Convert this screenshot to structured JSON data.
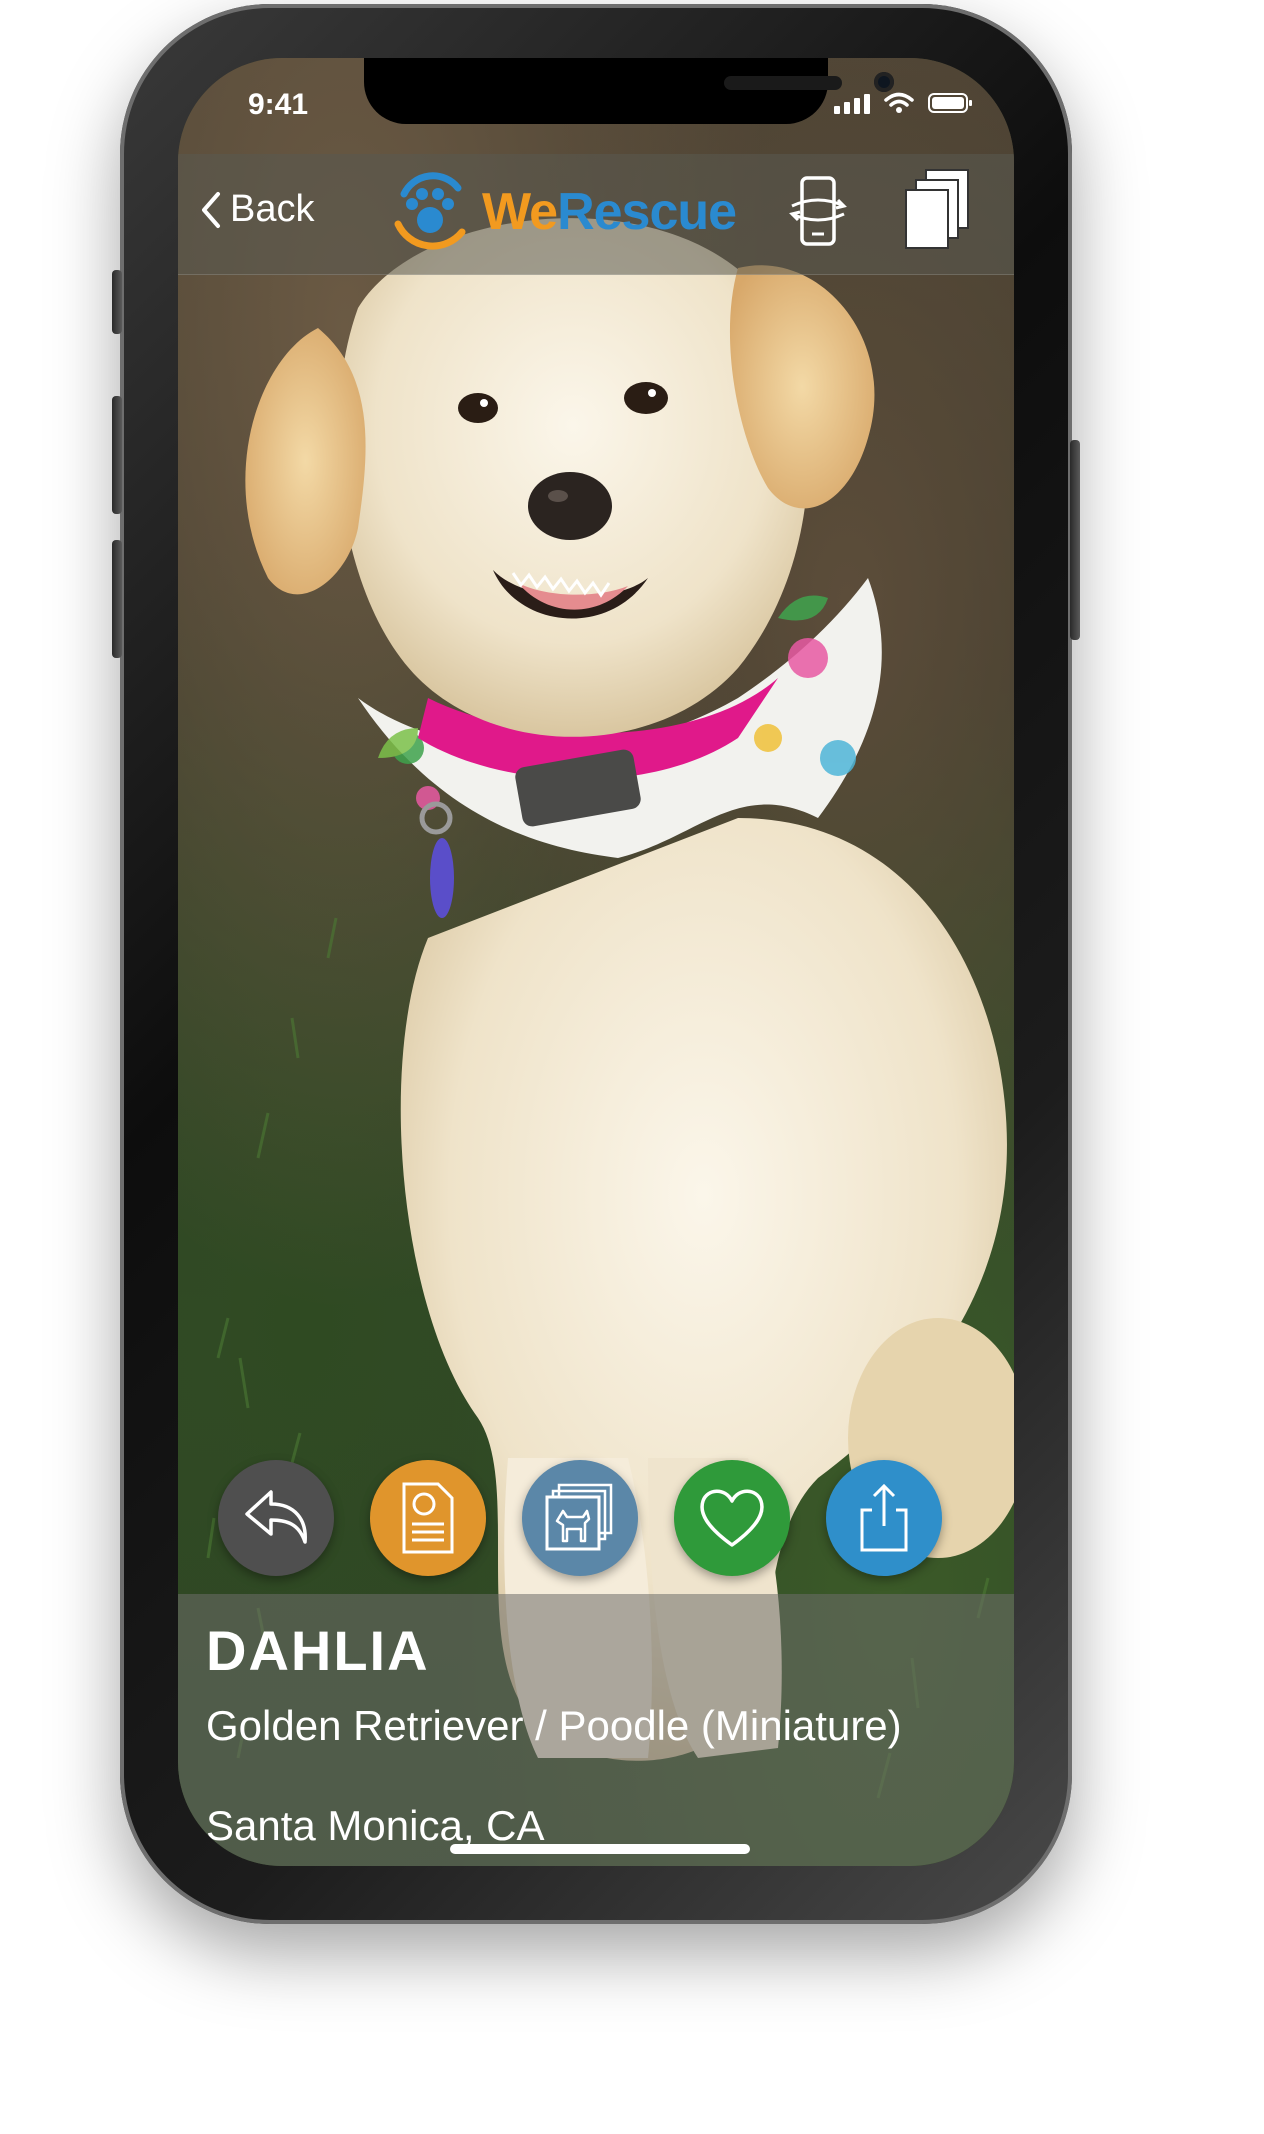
{
  "status_bar": {
    "time": "9:41"
  },
  "nav": {
    "back_label": "Back",
    "logo_we": "We",
    "logo_rescue": "Rescue",
    "icons": [
      "phone-rotate-icon",
      "cards-stack-icon"
    ]
  },
  "actions": [
    {
      "icon": "reply-arrow-icon",
      "color": "#4f4f4f"
    },
    {
      "icon": "application-form-icon",
      "color": "#e0952c"
    },
    {
      "icon": "dog-gallery-icon",
      "color": "#5b87a8"
    },
    {
      "icon": "heart-icon",
      "color": "#2f9a3a"
    },
    {
      "icon": "share-icon",
      "color": "#2f8fca"
    }
  ],
  "pet": {
    "name": "DAHLIA",
    "breed": "Golden Retriever / Poodle (Miniature)",
    "location": "Santa Monica, CA"
  }
}
